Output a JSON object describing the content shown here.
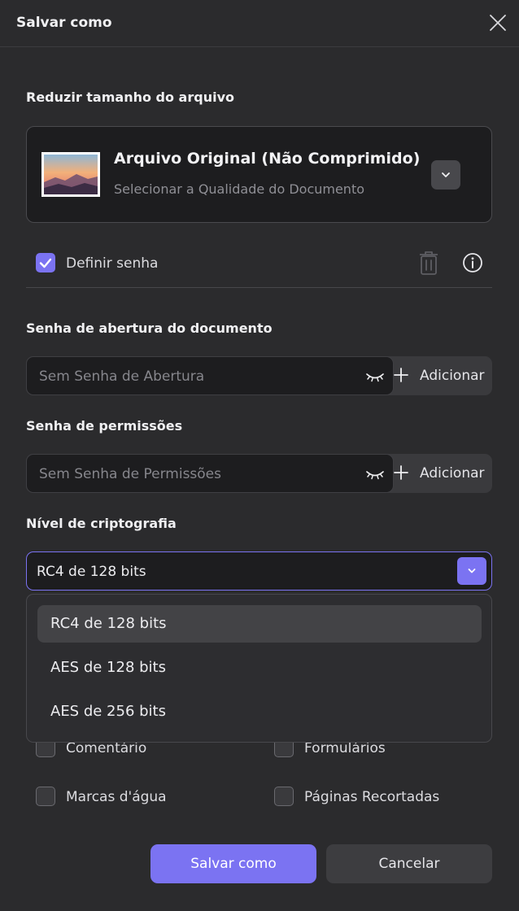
{
  "dialog": {
    "title": "Salvar como"
  },
  "compress": {
    "label": "Reduzir tamanho do arquivo",
    "card_title": "Arquivo Original (Não Comprimido)",
    "card_subtitle": "Selecionar a Qualidade do Documento"
  },
  "password": {
    "set_label": "Definir senha",
    "set_checked": true,
    "open_label": "Senha de abertura do documento",
    "open_placeholder": "Sem Senha de Abertura",
    "open_add": "Adicionar",
    "perm_label": "Senha de permissões",
    "perm_placeholder": "Sem Senha de Permissões",
    "perm_add": "Adicionar"
  },
  "encryption": {
    "label": "Nível de criptografia",
    "selected": "RC4 de 128 bits",
    "options": [
      "RC4 de 128 bits",
      "AES de 128 bits",
      "AES de 256 bits"
    ],
    "accent": "#7b73f2"
  },
  "permissions": {
    "items": [
      {
        "label": "Comentário",
        "checked": false
      },
      {
        "label": "Formulários",
        "checked": false
      },
      {
        "label": "Marcas d'água",
        "checked": false
      },
      {
        "label": "Páginas Recortadas",
        "checked": false
      }
    ]
  },
  "footer": {
    "save": "Salvar como",
    "cancel": "Cancelar"
  }
}
